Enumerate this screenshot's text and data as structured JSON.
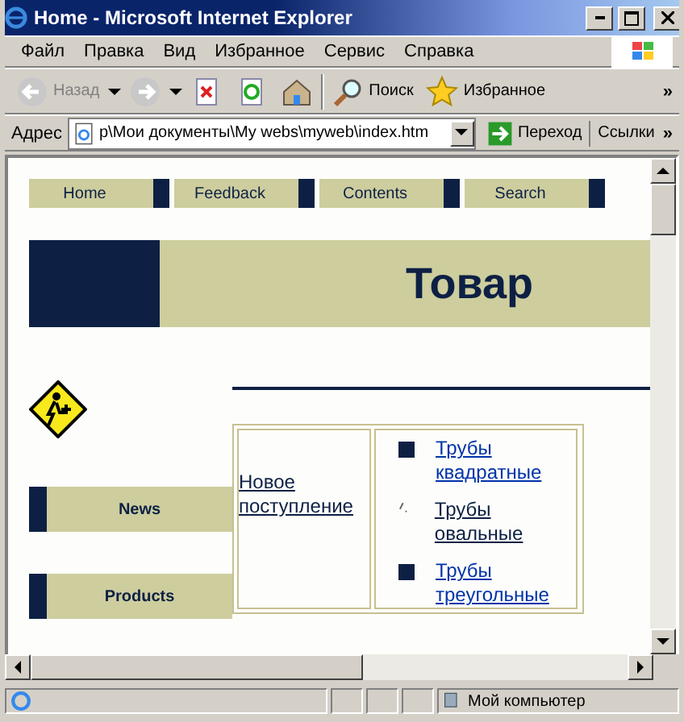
{
  "window": {
    "title": "Home - Microsoft Internet Explorer"
  },
  "menu": [
    "Файл",
    "Правка",
    "Вид",
    "Избранное",
    "Сервис",
    "Справка"
  ],
  "toolbar": {
    "back": {
      "label": "Назад",
      "disabled": true
    },
    "search": "Поиск",
    "favorites": "Избранное",
    "more": "»"
  },
  "address": {
    "label": "Адрес",
    "value": "p\\Мои документы\\My webs\\myweb\\index.htm",
    "go": "Переход",
    "links": "Ссылки",
    "more": "»"
  },
  "page": {
    "nav": [
      "Home",
      "Feedback",
      "Contents",
      "Search"
    ],
    "banner": "Товар",
    "side": [
      "News",
      "Products"
    ],
    "table": {
      "link": {
        "text": "Новое поступление",
        "visited": true
      },
      "items": [
        {
          "kind": "square",
          "text": "Трубы квадратные",
          "visited": false
        },
        {
          "kind": "broken",
          "text": "Трубы овальные",
          "visited": true
        },
        {
          "kind": "square",
          "text": "Трубы треугольные",
          "visited": false
        }
      ]
    }
  },
  "status_bar": {
    "zone": "Мой компьютер"
  }
}
